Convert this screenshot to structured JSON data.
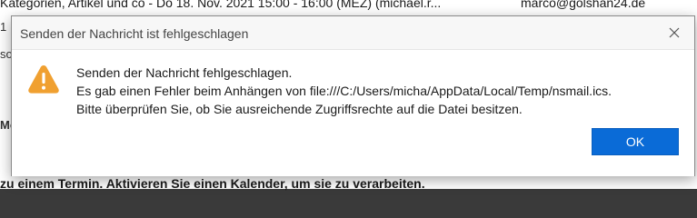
{
  "background": {
    "subject_line": "Kategorien, Artikel und co - Do 18. Nov. 2021 15:00 - 16:00 (MEZ) (michael.r...",
    "recipient": "marco@golshan24.de",
    "left_fragments": [
      "1",
      "so",
      "Mo"
    ],
    "bottom_line": "zu einem Termin. Aktivieren Sie einen Kalender, um sie zu verarbeiten."
  },
  "dialog": {
    "title": "Senden der Nachricht ist fehlgeschlagen",
    "icon": "warning-icon",
    "message_lines": [
      "Senden der Nachricht fehlgeschlagen.",
      "Es gab einen Fehler beim Anhängen von file:///C:/Users/micha/AppData/Local/Temp/nsmail.ics.",
      "Bitte überprüfen Sie, ob Sie ausreichende Zugriffsrechte auf die Datei besitzen."
    ],
    "ok_label": "OK",
    "close_icon": "close-icon"
  },
  "colors": {
    "accent": "#0a6bd7",
    "warning": "#f0a030"
  }
}
